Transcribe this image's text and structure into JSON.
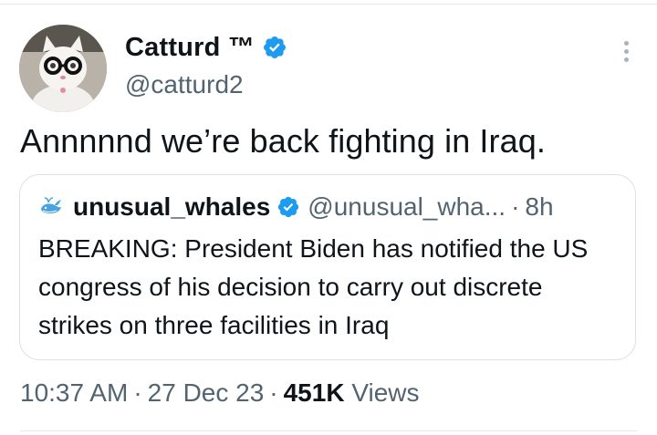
{
  "author": {
    "display_name": "Catturd ™",
    "handle": "@catturd2",
    "avatar_icon": "cat-with-glasses-avatar",
    "verified": true
  },
  "tweet": {
    "text": "Annnnnd we’re back fighting in Iraq."
  },
  "quoted_tweet": {
    "display_name": "unusual_whales",
    "handle": "@unusual_wha...",
    "separator": "·",
    "time": "8h",
    "avatar_icon": "whale-avatar",
    "verified": true,
    "text": "BREAKING: President Biden has notified the US congress of his decision to carry out discrete strikes on three facilities in Iraq"
  },
  "meta": {
    "time": "10:37 AM",
    "separator": "·",
    "date": "27 Dec 23",
    "views_count": "451K",
    "views_label": "Views"
  },
  "colors": {
    "verified_badge": "#1d9bf0",
    "secondary_text": "#536471",
    "primary_text": "#0f1419",
    "border": "#dbe0e4"
  },
  "icons": {
    "more": "more-vertical-icon",
    "verified": "verified-badge-icon"
  }
}
